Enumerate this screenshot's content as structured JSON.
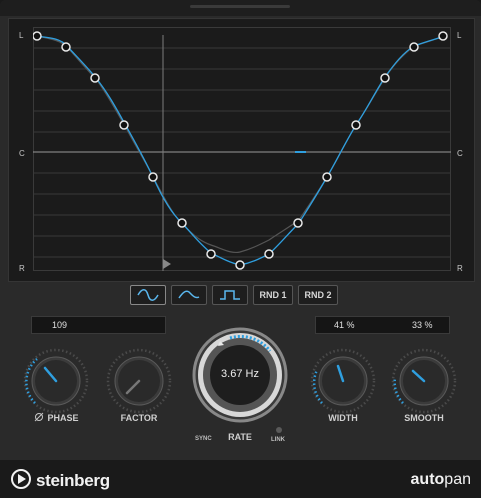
{
  "graph": {
    "top_left": "L",
    "top_right": "L",
    "mid_left": "C",
    "mid_right": "C",
    "bottom_left": "R",
    "bottom_right": "R"
  },
  "shape_buttons": {
    "rnd1": "RND 1",
    "rnd2": "RND 2"
  },
  "phase": {
    "value": "109",
    "label": "PHASE"
  },
  "factor": {
    "label": "FACTOR"
  },
  "rate": {
    "value": "3.67 Hz",
    "label": "RATE",
    "sync": "SYNC",
    "link": "LINK"
  },
  "width": {
    "value": "41 %",
    "label": "WIDTH"
  },
  "smooth": {
    "value": "33 %",
    "label": "SMOOTH"
  },
  "footer": {
    "brand": "steinberg",
    "product_bold": "auto",
    "product_rest": "pan"
  },
  "colors": {
    "accent": "#2f9fdf",
    "panel": "#2a2a2a",
    "graph_bg": "#1b1b1b"
  }
}
